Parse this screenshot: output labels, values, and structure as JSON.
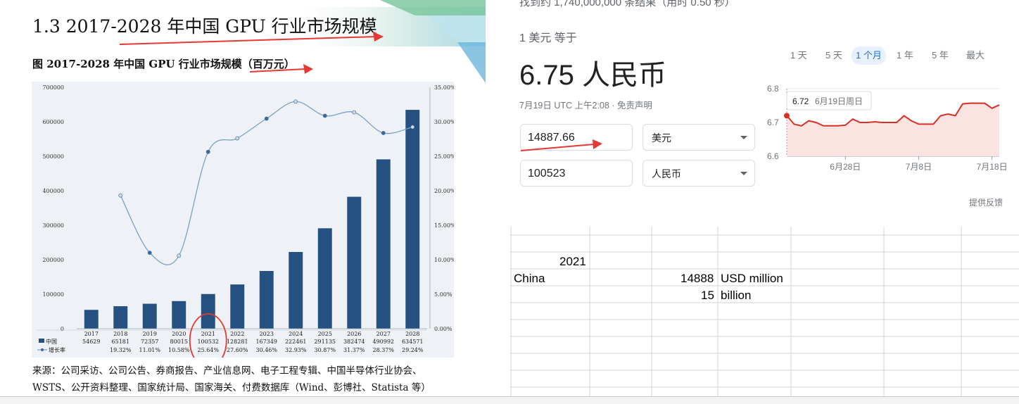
{
  "slide": {
    "title": "1.3 2017-2028 年中国 GPU 行业市场规模",
    "figure_caption": "图 2017-2028 年中国 GPU 行业市场规模（百万元）",
    "source_line1": "来源：公司采访、公司公告、券商报告、产业信息网、电子工程专辑、中国半导体行业协会、",
    "source_line2": "WSTS、公开资料整理、国家统计局、国家海关、付费数据库（Wind、彭博社、Statista 等）"
  },
  "chart_data": {
    "type": "bar",
    "title": "图 2017-2028 年中国 GPU 行业市场规模（百万元）",
    "categories": [
      "2017",
      "2018",
      "2019",
      "2020",
      "2021",
      "2022",
      "2023",
      "2024",
      "2025",
      "2026",
      "2027",
      "2028"
    ],
    "series": [
      {
        "name": "中国",
        "type": "bar",
        "values": [
          54629,
          65181,
          72357,
          80015,
          100532,
          128281,
          167349,
          222461,
          291135,
          382474,
          490992,
          634571
        ],
        "color": "#24517f"
      },
      {
        "name": "增长率",
        "type": "line",
        "values": [
          null,
          19.32,
          11.01,
          10.58,
          25.64,
          27.6,
          30.46,
          32.93,
          30.87,
          31.37,
          28.37,
          29.24
        ],
        "color": "#7d9fc6"
      }
    ],
    "growth_labels": [
      "",
      "19.32%",
      "11.01%",
      "10.58%",
      "25.64%",
      "27.60%",
      "30.46%",
      "32.93%",
      "30.87%",
      "31.37%",
      "28.37%",
      "29.24%"
    ],
    "y_left_ticks": [
      "700000",
      "600000",
      "500000",
      "400000",
      "300000",
      "200000",
      "100000",
      "0"
    ],
    "y_right_ticks": [
      "35.00%",
      "30.00%",
      "25.00%",
      "20.00%",
      "15.00%",
      "10.00%",
      "5.00%",
      "0.00%"
    ],
    "ylim_left": [
      0,
      700000
    ],
    "ylim_right": [
      0,
      35
    ],
    "legend": [
      "中国",
      "增长率"
    ],
    "highlight_category": "2021"
  },
  "widget": {
    "results_count": "找到约 1,740,000,000 条结果（用时 0.50 秒）",
    "conversion_label": "1 美元 等于",
    "conversion_result": "6.75 人民币",
    "timestamp": "7月19日 UTC 上午2:08 · 免责声明",
    "amount_from": "14887.66",
    "currency_from": "美元",
    "amount_to": "100523",
    "currency_to": "人民币",
    "range_tabs": [
      "1 天",
      "5 天",
      "1 个月",
      "1 年",
      "5 年",
      "最大"
    ],
    "active_tab": "1 个月",
    "feedback": "提供反馈",
    "mini_chart": {
      "type": "area",
      "y_ticks": [
        "6.8",
        "6.7",
        "6.6"
      ],
      "ylim": [
        6.6,
        6.8
      ],
      "x_ticks": [
        "6月28日",
        "7月8日",
        "7月18日"
      ],
      "values": [
        6.72,
        6.695,
        6.69,
        6.705,
        6.7,
        6.69,
        6.69,
        6.69,
        6.692,
        6.71,
        6.7,
        6.7,
        6.702,
        6.7,
        6.7,
        6.7,
        6.72,
        6.705,
        6.695,
        6.695,
        6.695,
        6.72,
        6.725,
        6.72,
        6.755,
        6.757,
        6.757,
        6.757,
        6.742,
        6.752
      ],
      "tooltip_value": "6.72",
      "tooltip_date": "6月19日周日",
      "color": "#d93025"
    }
  },
  "sheet": {
    "year": "2021",
    "country": "China",
    "value_usd_million": "14888",
    "unit_usd_million": "USD million",
    "value_billion": "15",
    "unit_billion": "billion"
  }
}
